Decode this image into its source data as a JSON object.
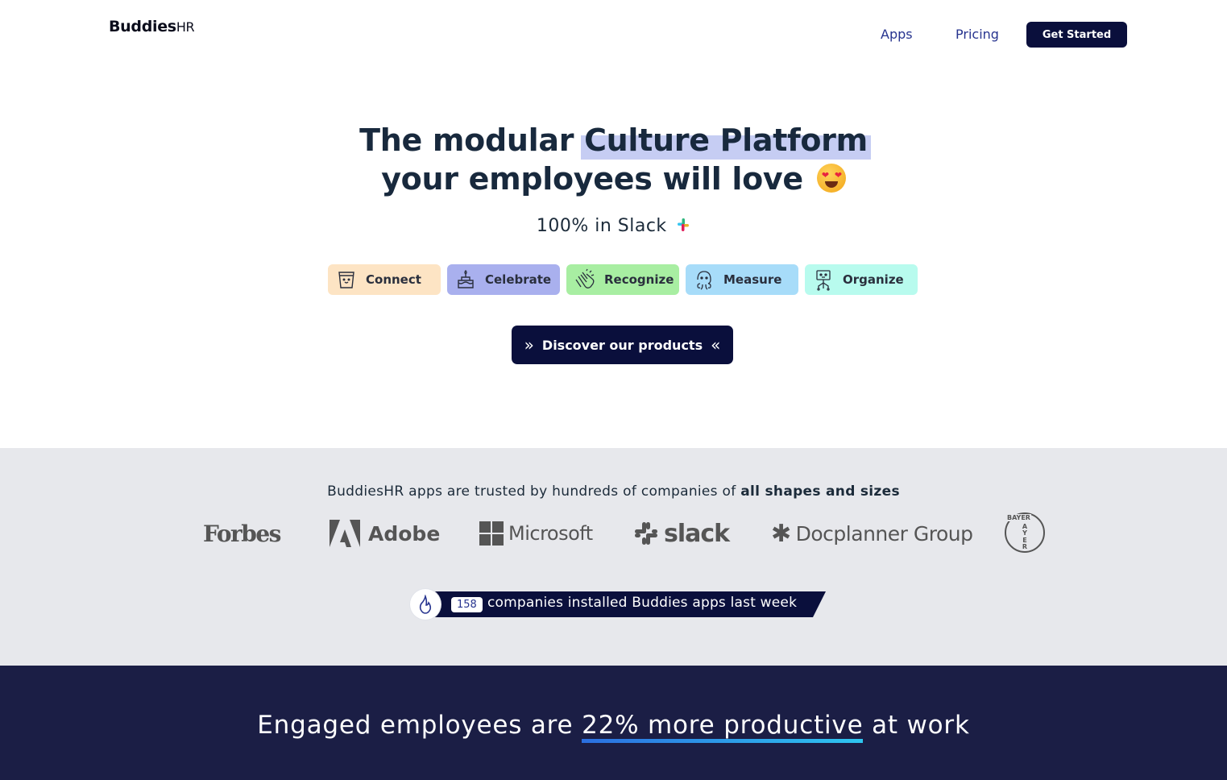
{
  "header": {
    "logo_bold": "Buddies",
    "logo_regular": "HR",
    "nav": {
      "apps": "Apps",
      "pricing": "Pricing"
    },
    "cta": "Get Started"
  },
  "hero": {
    "title_prefix": "The modular ",
    "title_highlight": "Culture Platform",
    "title_line2": "your employees will love",
    "emoji": "heart-eyes-emoji",
    "subtitle": "100% in Slack",
    "pills": [
      {
        "label": "Connect",
        "icon": "cup-icon",
        "color": "#fde4c4"
      },
      {
        "label": "Celebrate",
        "icon": "cake-icon",
        "color": "#a9b0ee"
      },
      {
        "label": "Recognize",
        "icon": "clapping-hands-icon",
        "color": "#a8eea2"
      },
      {
        "label": "Measure",
        "icon": "octopus-icon",
        "color": "#a7dcf9"
      },
      {
        "label": "Organize",
        "icon": "robot-icon",
        "color": "#b8fbee"
      }
    ],
    "discover": "Discover our products"
  },
  "trust": {
    "text_prefix": "BuddiesHR apps are trusted by hundreds of companies of ",
    "text_bold": "all shapes and sizes",
    "logos": {
      "forbes": "Forbes",
      "adobe": "Adobe",
      "microsoft": "Microsoft",
      "slack": "slack",
      "docplanner": "Docplanner Group",
      "bayer": "BAYER"
    },
    "installs_count": "158",
    "installs_text": "companies installed Buddies apps last week"
  },
  "stat": {
    "prefix": "Engaged employees are ",
    "highlight": "22% more productive",
    "suffix": " at work"
  },
  "colors": {
    "navy": "#0a0f3c",
    "dark_band": "#1b1e45",
    "link": "#27348f",
    "highlight": "#c6cdf3"
  }
}
